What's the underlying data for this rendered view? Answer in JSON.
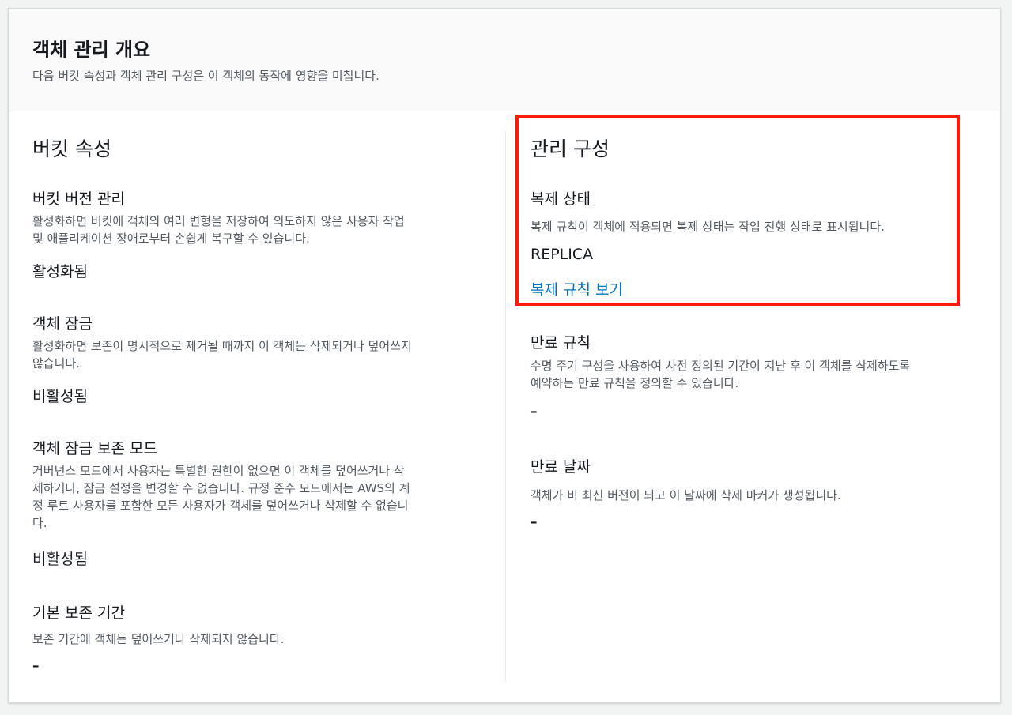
{
  "header": {
    "title": "객체 관리 개요",
    "description": "다음 버킷 속성과 객체 관리 구성은 이 객체의 동작에 영향을 미칩니다."
  },
  "bucket_properties": {
    "title": "버킷 속성",
    "versioning": {
      "label": "버킷 버전 관리",
      "desc_lines": [
        "활성화하면 버킷에 객체의 여러 변형을 저장하여 의도하지 않은 사용자 작업",
        "및 애플리케이션 장애로부터 손쉽게 복구할 수 있습니다."
      ],
      "value": "활성화됨"
    },
    "object_lock": {
      "label": "객체 잠금",
      "desc_lines": [
        "활성화하면 보존이 명시적으로 제거될 때까지 이 객체는 삭제되거나 덮어쓰지",
        "않습니다."
      ],
      "value": "비활성됨"
    },
    "lock_retention_mode": {
      "label": "객체 잠금 보존 모드",
      "desc_lines": [
        "거버넌스 모드에서 사용자는 특별한 권한이 없으면 이 객체를 덮어쓰거나 삭",
        "제하거나, 잠금 설정을 변경할 수 없습니다. 규정 준수 모드에서는 AWS의 계",
        "정 루트 사용자를 포함한 모든 사용자가 객체를 덮어쓰거나 삭제할 수 없습니",
        "다."
      ],
      "value": "비활성됨"
    },
    "default_retention": {
      "label": "기본 보존 기간",
      "desc_lines": [
        "보존 기간에 객체는 덮어쓰거나 삭제되지 않습니다."
      ],
      "value": "–"
    }
  },
  "management_config": {
    "title": "관리 구성",
    "replication_status": {
      "label": "복제 상태",
      "desc": "복제 규칙이 객체에 적용되면 복제 상태는 작업 진행 상태로 표시됩니다.",
      "value": "REPLICA",
      "link": "복제 규칙 보기"
    },
    "expiration_rule": {
      "label": "만료 규칙",
      "desc_lines": [
        "수명 주기 구성을 사용하여 사전 정의된 기간이 지난 후 이 객체를 삭제하도록",
        "예약하는 만료 규칙을 정의할 수 있습니다."
      ],
      "value": "–"
    },
    "expiration_date": {
      "label": "만료 날짜",
      "desc": "객체가 비 최신 버전이 되고 이 날짜에 삭제 마커가 생성됩니다.",
      "value": "–"
    }
  },
  "colors": {
    "highlight_border": "#ff1a0a",
    "link": "#0073bb"
  }
}
